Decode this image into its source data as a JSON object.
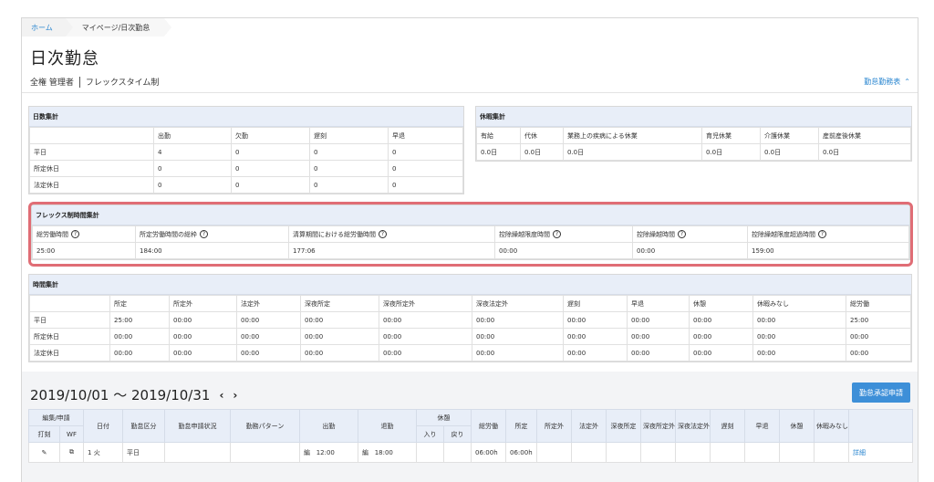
{
  "breadcrumb": {
    "home": "ホーム",
    "current": "マイページ/日次勤怠"
  },
  "page": {
    "title": "日次勤怠",
    "role": "全権 管理者",
    "work_style": "フレックスタイム制",
    "toggle_link": "勤怠勤務表"
  },
  "days": {
    "title": "日数集計",
    "headers": [
      "",
      "出勤",
      "欠勤",
      "遅刻",
      "早退"
    ],
    "rows": [
      [
        "平日",
        "4",
        "0",
        "0",
        "0"
      ],
      [
        "所定休日",
        "0",
        "0",
        "0",
        "0"
      ],
      [
        "法定休日",
        "0",
        "0",
        "0",
        "0"
      ]
    ]
  },
  "leave": {
    "title": "休暇集計",
    "headers": [
      "有給",
      "代休",
      "業務上の疾病による休業",
      "育児休業",
      "介護休業",
      "産前産後休業"
    ],
    "values": [
      "0.0日",
      "0.0日",
      "0.0日",
      "0.0日",
      "0.0日",
      "0.0日"
    ]
  },
  "flex": {
    "title": "フレックス制時間集計",
    "headers": [
      "総労働時間",
      "所定労働時間の総枠",
      "清算期間における総労働時間",
      "控除繰越限度時間",
      "控除繰越時間",
      "控除繰越限度超過時間"
    ],
    "values": [
      "25:00",
      "184:00",
      "177:06",
      "00:00",
      "00:00",
      "159:00"
    ]
  },
  "hours": {
    "title": "時間集計",
    "headers": [
      "",
      "所定",
      "所定外",
      "法定外",
      "深夜所定",
      "深夜所定外",
      "深夜法定外",
      "遅刻",
      "早退",
      "休憩",
      "休暇みなし",
      "総労働"
    ],
    "rows": [
      [
        "平日",
        "25:00",
        "00:00",
        "00:00",
        "00:00",
        "00:00",
        "00:00",
        "00:00",
        "00:00",
        "00:00",
        "00:00",
        "25:00"
      ],
      [
        "所定休日",
        "00:00",
        "00:00",
        "00:00",
        "00:00",
        "00:00",
        "00:00",
        "00:00",
        "00:00",
        "00:00",
        "00:00",
        "00:00"
      ],
      [
        "法定休日",
        "00:00",
        "00:00",
        "00:00",
        "00:00",
        "00:00",
        "00:00",
        "00:00",
        "00:00",
        "00:00",
        "00:00",
        "00:00"
      ]
    ]
  },
  "period": {
    "range": "2019/10/01 〜 2019/10/31",
    "prev": "‹",
    "next": "›",
    "approve_button": "勤怠承認申請"
  },
  "daily": {
    "h_edit": "編集/申請",
    "h_stamp": "打刻",
    "h_wf": "WF",
    "h_date": "日付",
    "h_kind": "勤怠区分",
    "h_status": "勤怠申請状況",
    "h_pattern": "勤務パターン",
    "h_in": "出勤",
    "h_out": "退勤",
    "h_break": "休憩",
    "h_break_in": "入り",
    "h_break_out": "戻り",
    "h_total": "総労働",
    "h_fixed": "所定",
    "h_over": "所定外",
    "h_legal": "法定外",
    "h_night1": "深夜所定",
    "h_night2": "深夜所定外",
    "h_night3": "深夜法定外",
    "h_late": "遅刻",
    "h_early": "早退",
    "h_rest": "休憩",
    "h_leave": "休暇みなし",
    "row": {
      "day": "1",
      "weekday": "火",
      "kind": "平日",
      "in_tag": "編",
      "in": "12:00",
      "out_tag": "編",
      "out": "18:00",
      "total": "06:00h",
      "fixed": "06:00h",
      "detail": "詳細"
    }
  }
}
